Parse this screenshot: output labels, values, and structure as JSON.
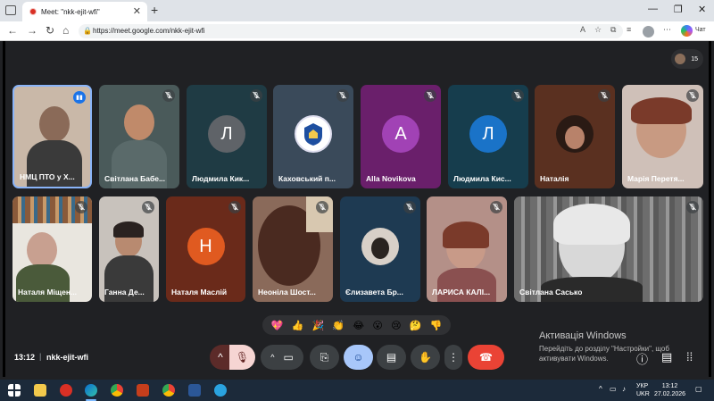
{
  "browser": {
    "tab_title": "Meet: \"nkk-ejit-wfi\"",
    "url": "https://meet.google.com/nkk-ejit-wfi",
    "chat_label": "Чат"
  },
  "meet": {
    "participant_count": "15",
    "meeting_time": "13:12",
    "meeting_code": "nkk-ejit-wfi",
    "tiles": [
      {
        "name": "НМЦ ПТО у Х...",
        "initial": "",
        "bg": "#c9b8a8"
      },
      {
        "name": "Світлана Бабе...",
        "initial": "",
        "bg": "#4a5a5a"
      },
      {
        "name": "Людмила Кик...",
        "initial": "Л",
        "bg": "#1f3b44",
        "avatar": "#5f6368"
      },
      {
        "name": "Каховський п...",
        "initial": "",
        "bg": "#3a4a5a"
      },
      {
        "name": "Alla Novikova",
        "initial": "A",
        "bg": "#6a1f6b",
        "avatar": "#a142b5"
      },
      {
        "name": "Людмила Кис...",
        "initial": "Л",
        "bg": "#163d4d",
        "avatar": "#1a73c8"
      },
      {
        "name": "Наталія",
        "initial": "",
        "bg": "#5a3020"
      },
      {
        "name": "Марія Перетя...",
        "initial": "",
        "bg": "#cfc0b8"
      },
      {
        "name": "Наталя Міщен...",
        "initial": "",
        "bg": "#e9e6df"
      },
      {
        "name": "Ганна Де...",
        "initial": "",
        "bg": "#c8c2bc"
      },
      {
        "name": "Наталя Маслій",
        "initial": "Н",
        "bg": "#6a2a1a",
        "avatar": "#e05a20"
      },
      {
        "name": "Неоніла Шост...",
        "initial": "",
        "bg": "#8a6a5a"
      },
      {
        "name": "Єлизавета Бр...",
        "initial": "",
        "bg": "#1e3a52"
      },
      {
        "name": "ЛАРИСА КАЛІ...",
        "initial": "",
        "bg": "#b49088"
      },
      {
        "name": "Світлана Сасько",
        "initial": "",
        "bg": "#8a8a8a"
      }
    ],
    "reactions": [
      "💖",
      "👍",
      "🎉",
      "👏",
      "😂",
      "😮",
      "😢",
      "🤔",
      "👎"
    ],
    "activation_title": "Активація Windows",
    "activation_text": "Перейдіть до розділу \"Настройки\", щоб активувати Windows."
  },
  "taskbar": {
    "lang1": "УКР",
    "lang2": "UKR",
    "time": "13:12",
    "date": "27.02.2026"
  }
}
